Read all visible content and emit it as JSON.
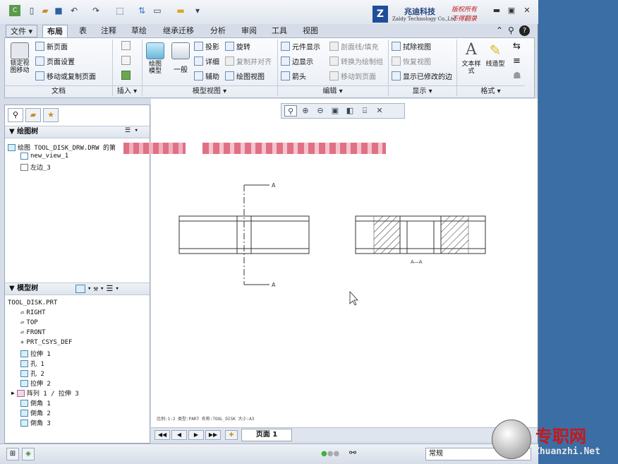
{
  "titlebar": {
    "quick_access": [
      "new-icon",
      "open-icon",
      "save-icon",
      "undo-icon",
      "redo-icon",
      "select-icon",
      "regenerate-icon",
      "windows-icon",
      "close-file-icon",
      "more-icon"
    ],
    "logo": {
      "mark": "Z",
      "company": "兆迪科技",
      "english": "Zaldy Technology Co.,Ltd.",
      "note1": "版权所有",
      "note2": "不得翻录"
    }
  },
  "tabs": [
    "文件 ▾",
    "布局",
    "表",
    "注释",
    "草绘",
    "继承迁移",
    "分析",
    "审阅",
    "工具",
    "视图"
  ],
  "ribbon": {
    "doc": {
      "lock": "锁定视图移动",
      "new_page": "新页面",
      "page_setup": "页面设置",
      "move_copy": "移动或复制页面",
      "group": "文档"
    },
    "insert": {
      "group": "插入 ▾"
    },
    "model_view": {
      "drawing_model": "绘图模型",
      "general": "一般",
      "projection": "投影",
      "detail": "详细",
      "auxiliary": "辅助",
      "revolve": "旋转",
      "copy_align": "复制并对齐",
      "drawing_view": "绘图视图",
      "group": "模型视图 ▾"
    },
    "edit": {
      "component_display": "元件显示",
      "edge_display": "边显示",
      "arrow": "箭头",
      "section_line": "剖面线/填充",
      "convert": "转换为绘制组",
      "move_to_page": "移动到页面",
      "group": "编辑 ▾"
    },
    "display": {
      "erase_view": "拭除视图",
      "restore_view": "恢复视图",
      "show_modified": "显示已修改的边",
      "group": "显示 ▾"
    },
    "format": {
      "text_style": "文本样式",
      "line_style": "线造型",
      "group": "格式 ▾"
    }
  },
  "drawing_tree": {
    "header": "绘图树",
    "items": [
      "绘图 TOOL_DISK_DRW.DRW 的第",
      "new_view_1",
      "左边_3"
    ]
  },
  "model_tree": {
    "header": "模型树",
    "items": [
      "TOOL_DISK.PRT",
      "RIGHT",
      "TOP",
      "FRONT",
      "PRT_CSYS_DEF",
      "拉伸 1",
      "孔 1",
      "孔 2",
      "拉伸 2",
      "阵列 1 / 拉伸 3",
      "倒角 1",
      "倒角 2",
      "倒角 3"
    ]
  },
  "canvas": {
    "section_label_top": "A",
    "section_label_bottom": "A",
    "section_caption": "A—A",
    "info": "比例:1:2     类型:PART     名称:TOOL_DISK     大小:A3"
  },
  "pagebar": {
    "page_label": "页面 1"
  },
  "statusbar": {
    "filter": "常规"
  },
  "watermark": {
    "brand": "专职网",
    "url": "Zhuanzhi.Net"
  }
}
